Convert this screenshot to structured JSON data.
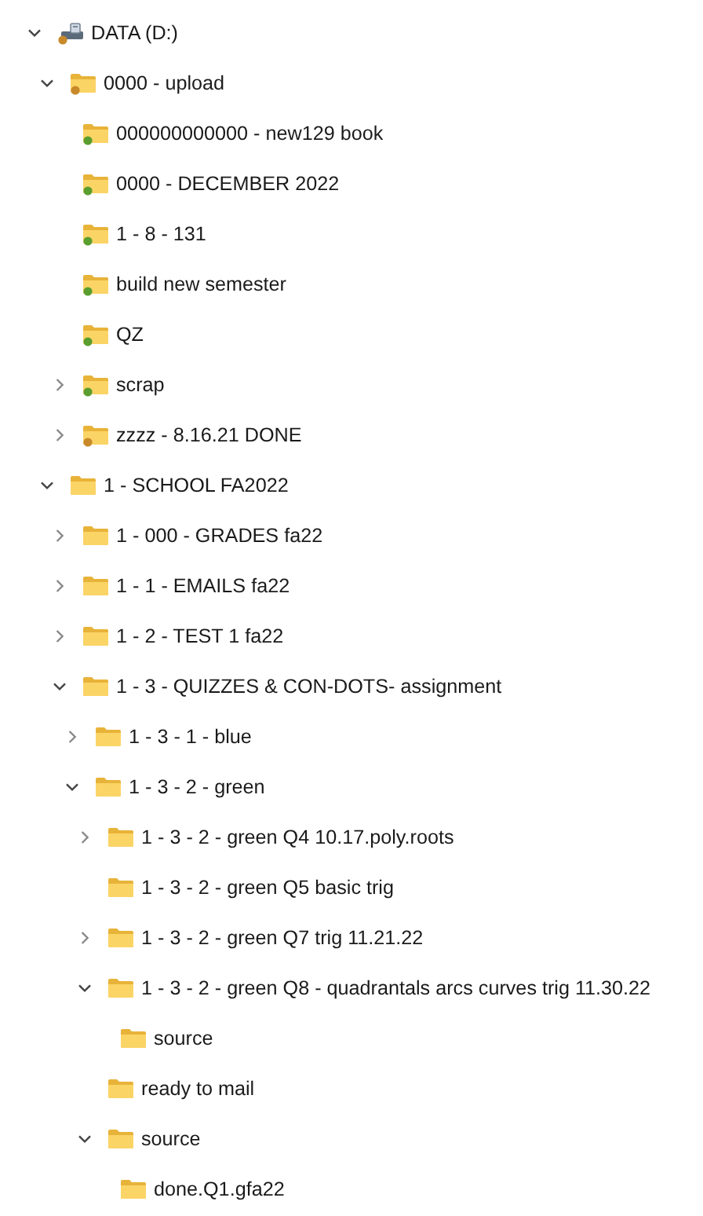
{
  "tree": [
    {
      "label": "DATA (D:)",
      "kind": "drive",
      "color": "#c8892a",
      "expanded": true,
      "children": [
        {
          "label": "0000 - upload",
          "kind": "folder",
          "color": "#c8892a",
          "expanded": true,
          "children": [
            {
              "label": "000000000000 - new129 book",
              "kind": "folder",
              "color": "#5a9e2f"
            },
            {
              "label": "0000 - DECEMBER 2022",
              "kind": "folder",
              "color": "#5a9e2f"
            },
            {
              "label": "1 - 8 - 131",
              "kind": "folder",
              "color": "#5a9e2f"
            },
            {
              "label": "build new semester",
              "kind": "folder",
              "color": "#5a9e2f"
            },
            {
              "label": "QZ",
              "kind": "folder",
              "color": "#5a9e2f"
            },
            {
              "label": "scrap",
              "kind": "folder",
              "color": "#5a9e2f",
              "expanded": false
            },
            {
              "label": "zzzz - 8.16.21 DONE",
              "kind": "folder",
              "color": "#c8892a",
              "expanded": false
            }
          ]
        },
        {
          "label": "1 - SCHOOL FA2022",
          "kind": "folder",
          "expanded": true,
          "children": [
            {
              "label": "1 - 000 - GRADES fa22",
              "kind": "folder",
              "expanded": false
            },
            {
              "label": "1 - 1 - EMAILS fa22",
              "kind": "folder",
              "expanded": false
            },
            {
              "label": "1 - 2 - TEST 1 fa22",
              "kind": "folder",
              "expanded": false
            },
            {
              "label": "1 - 3 - QUIZZES & CON-DOTS- assignment",
              "kind": "folder",
              "expanded": true,
              "children": [
                {
                  "label": "1 - 3 - 1 - blue",
                  "kind": "folder",
                  "expanded": false
                },
                {
                  "label": "1 - 3 - 2 - green",
                  "kind": "folder",
                  "expanded": true,
                  "children": [
                    {
                      "label": "1 - 3 - 2 - green Q4 10.17.poly.roots",
                      "kind": "folder",
                      "expanded": false
                    },
                    {
                      "label": "1 - 3 - 2 - green Q5 basic trig",
                      "kind": "folder"
                    },
                    {
                      "label": "1 - 3 - 2 - green Q7 trig 11.21.22",
                      "kind": "folder",
                      "expanded": false
                    },
                    {
                      "label": "1 - 3 - 2 - green Q8 - quadrantals arcs curves trig 11.30.22",
                      "kind": "folder",
                      "expanded": true,
                      "children": [
                        {
                          "label": "source",
                          "kind": "folder"
                        }
                      ]
                    },
                    {
                      "label": "ready to mail",
                      "kind": "folder"
                    },
                    {
                      "label": "source",
                      "kind": "folder",
                      "expanded": true,
                      "children": [
                        {
                          "label": "done.Q1.gfa22",
                          "kind": "folder"
                        }
                      ]
                    }
                  ]
                }
              ]
            }
          ]
        }
      ]
    }
  ]
}
